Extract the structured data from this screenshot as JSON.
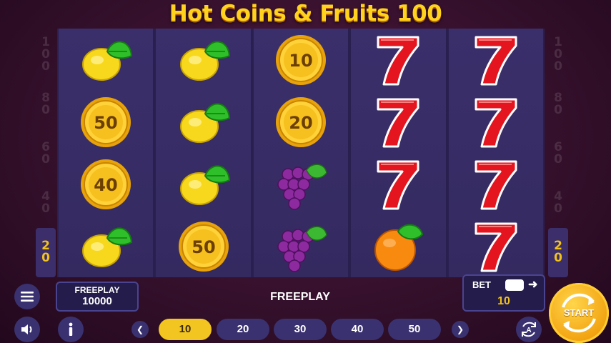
{
  "title": "Hot Coins & Fruits 100",
  "paylines": {
    "left": [
      "100",
      "80",
      "60",
      "40",
      "20"
    ],
    "right": [
      "100",
      "80",
      "60",
      "40",
      "20"
    ],
    "active": "20"
  },
  "reels": [
    [
      {
        "s": "lemon"
      },
      {
        "s": "coin",
        "v": "50"
      },
      {
        "s": "coin",
        "v": "40"
      },
      {
        "s": "lemon"
      }
    ],
    [
      {
        "s": "lemon"
      },
      {
        "s": "lemon"
      },
      {
        "s": "lemon"
      },
      {
        "s": "coin",
        "v": "50"
      }
    ],
    [
      {
        "s": "coin",
        "v": "10"
      },
      {
        "s": "coin",
        "v": "20"
      },
      {
        "s": "grapes"
      },
      {
        "s": "grapes"
      }
    ],
    [
      {
        "s": "seven"
      },
      {
        "s": "seven"
      },
      {
        "s": "seven"
      },
      {
        "s": "orange"
      }
    ],
    [
      {
        "s": "seven"
      },
      {
        "s": "seven"
      },
      {
        "s": "seven"
      },
      {
        "s": "seven"
      }
    ]
  ],
  "balance": {
    "label": "FREEPLAY",
    "value": "10000"
  },
  "status_text": "FREEPLAY",
  "bet": {
    "label": "BET",
    "value": "10"
  },
  "bet_options": [
    "10",
    "20",
    "30",
    "40",
    "50"
  ],
  "selected_bet": "10",
  "start_label": "START",
  "icons": {
    "menu": "menu-icon",
    "sound": "speaker-icon",
    "info": "info-icon",
    "autoplay": "autoplay-icon",
    "prev": "chevron-left-icon",
    "next": "chevron-right-icon"
  }
}
